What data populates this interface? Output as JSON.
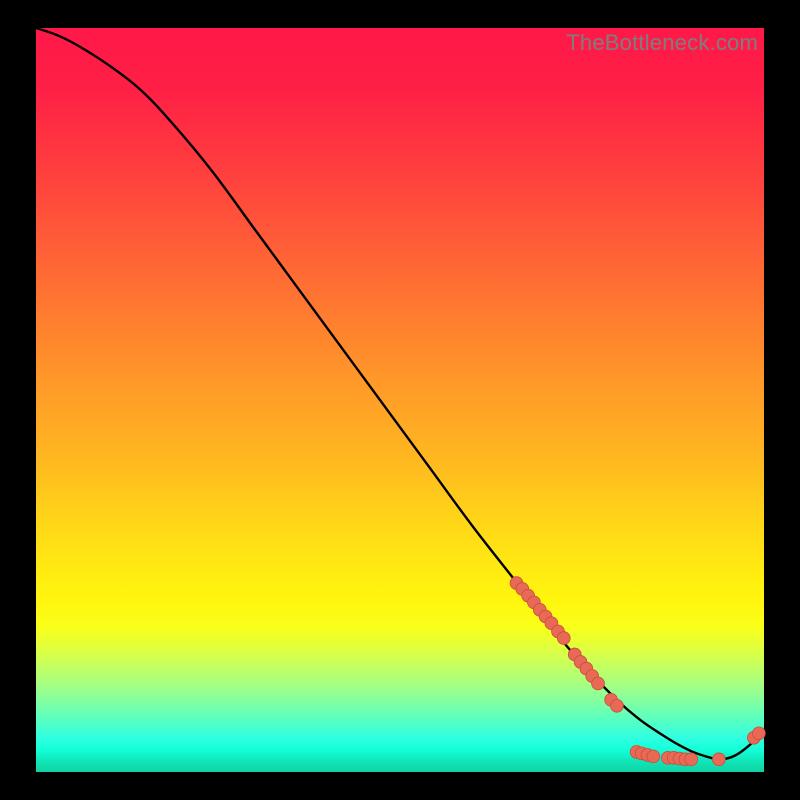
{
  "watermark": "TheBottleneck.com",
  "colors": {
    "curve_stroke": "#000000",
    "marker_fill": "#e86a56",
    "marker_stroke": "#c94d3a",
    "background": "#000000"
  },
  "chart_data": {
    "type": "line",
    "title": "",
    "xlabel": "",
    "ylabel": "",
    "xlim": [
      0,
      100
    ],
    "ylim": [
      0,
      100
    ],
    "grid": false,
    "legend_position": "none",
    "series": [
      {
        "name": "curve",
        "x": [
          0,
          3,
          6,
          10,
          14,
          18,
          24,
          30,
          36,
          42,
          48,
          54,
          60,
          66,
          72,
          76,
          80,
          83,
          86,
          88,
          90,
          92,
          94,
          96,
          98,
          100
        ],
        "y": [
          100,
          99,
          97.5,
          95,
          92,
          88,
          81,
          73,
          65,
          57,
          49,
          41,
          33,
          25.5,
          18,
          13.5,
          9.5,
          7,
          5,
          3.8,
          2.8,
          2.1,
          1.7,
          2.2,
          3.6,
          5.5
        ]
      }
    ],
    "markers": [
      {
        "x": 66.0,
        "y": 25.4
      },
      {
        "x": 66.8,
        "y": 24.6
      },
      {
        "x": 67.6,
        "y": 23.7
      },
      {
        "x": 68.4,
        "y": 22.8
      },
      {
        "x": 69.2,
        "y": 21.8
      },
      {
        "x": 70.0,
        "y": 20.9
      },
      {
        "x": 70.8,
        "y": 20.0
      },
      {
        "x": 71.7,
        "y": 18.9
      },
      {
        "x": 72.5,
        "y": 18.0
      },
      {
        "x": 74.0,
        "y": 15.8
      },
      {
        "x": 74.8,
        "y": 14.8
      },
      {
        "x": 75.6,
        "y": 13.9
      },
      {
        "x": 76.4,
        "y": 12.9
      },
      {
        "x": 77.2,
        "y": 11.9
      },
      {
        "x": 79.0,
        "y": 9.7
      },
      {
        "x": 79.8,
        "y": 8.9
      },
      {
        "x": 82.5,
        "y": 2.7
      },
      {
        "x": 83.2,
        "y": 2.5
      },
      {
        "x": 84.0,
        "y": 2.3
      },
      {
        "x": 84.8,
        "y": 2.1
      },
      {
        "x": 86.8,
        "y": 1.9
      },
      {
        "x": 87.6,
        "y": 1.9
      },
      {
        "x": 88.4,
        "y": 1.8
      },
      {
        "x": 89.2,
        "y": 1.7
      },
      {
        "x": 90.0,
        "y": 1.7
      },
      {
        "x": 93.8,
        "y": 1.7
      },
      {
        "x": 98.6,
        "y": 4.6
      },
      {
        "x": 99.3,
        "y": 5.2
      }
    ]
  }
}
